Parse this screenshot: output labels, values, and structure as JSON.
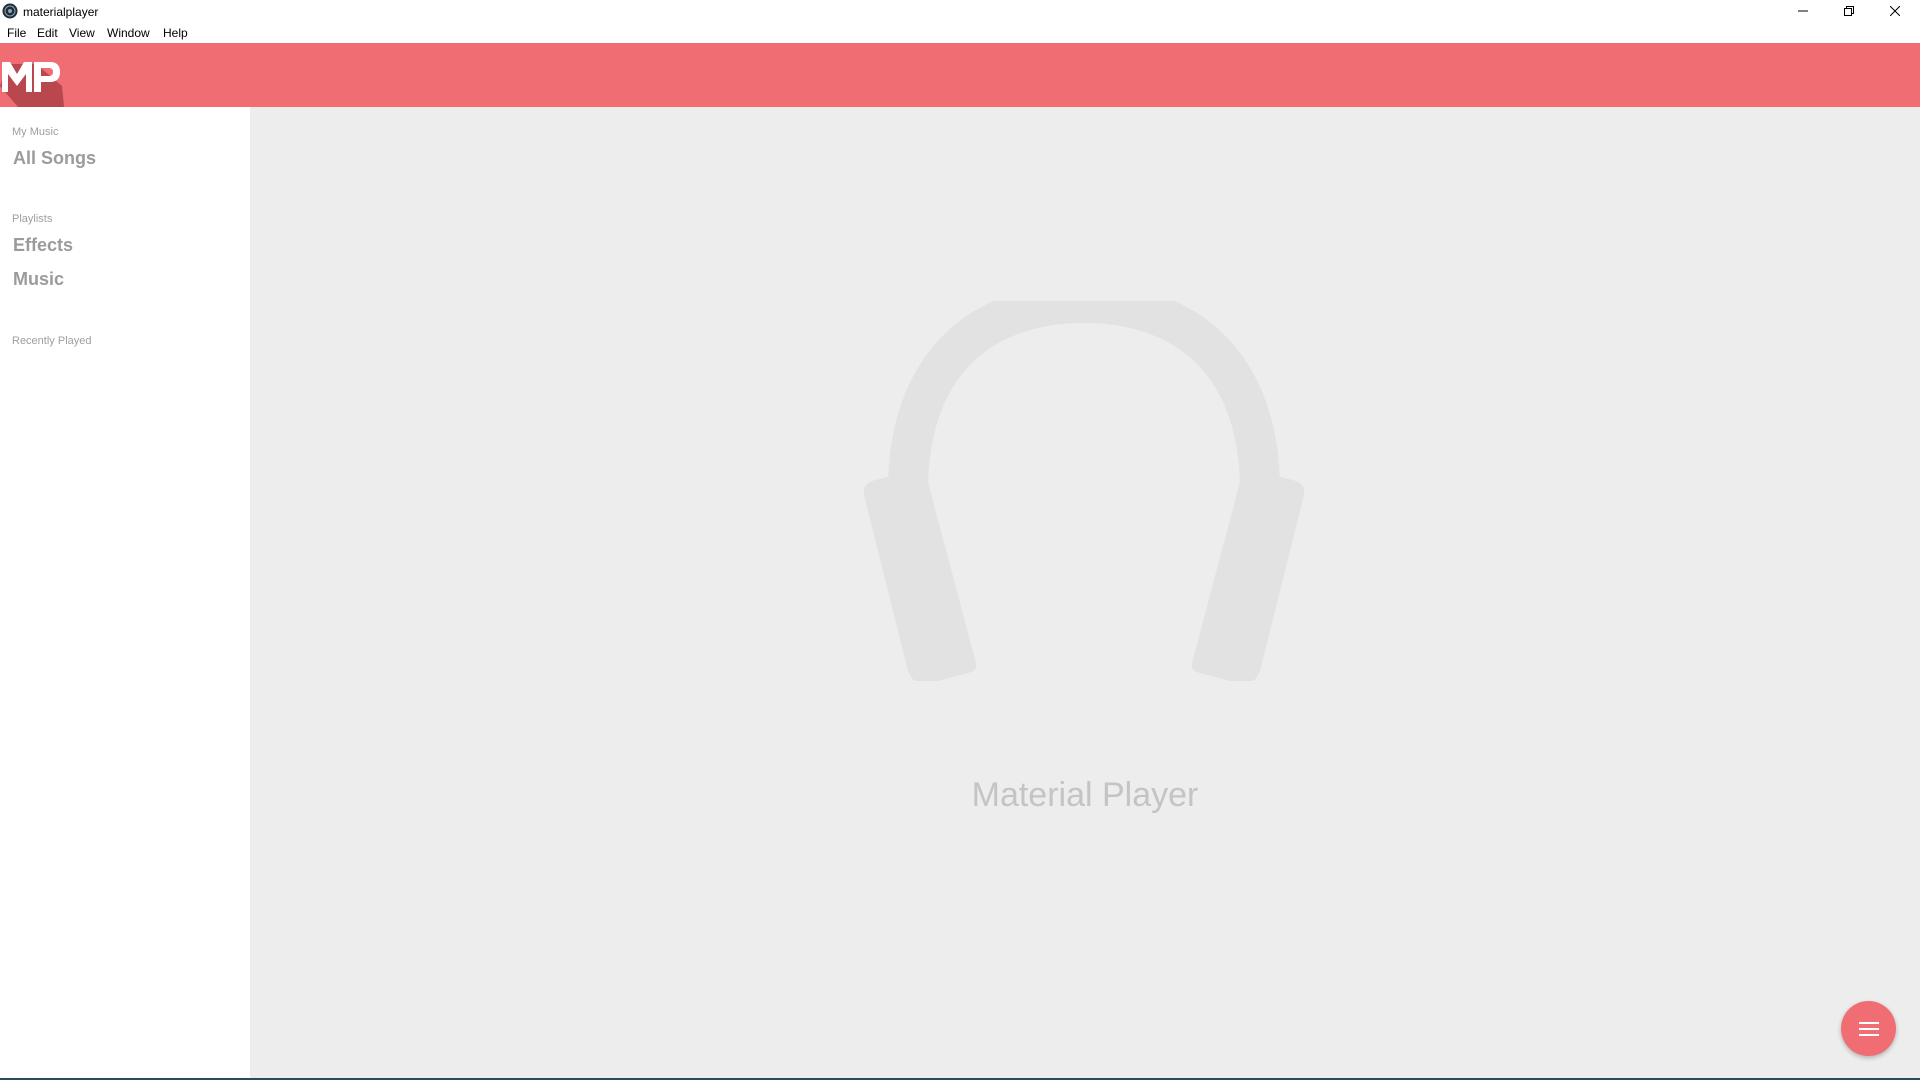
{
  "window": {
    "title": "materialplayer",
    "icon": "app-icon",
    "controls": [
      "minimize-icon",
      "maximize-icon",
      "close-icon"
    ]
  },
  "menu": {
    "file": "File",
    "edit": "Edit",
    "view": "View",
    "window": "Window",
    "help": "Help"
  },
  "header": {
    "logo_text": "MP",
    "accent_color": "#f06d74"
  },
  "sidebar": {
    "my_music_label": "My Music",
    "all_songs": "All Songs",
    "playlists_label": "Playlists",
    "playlists": [
      "Effects",
      "Music"
    ],
    "recently_played_label": "Recently Played"
  },
  "main": {
    "placeholder_icon": "headphones-icon",
    "app_name": "Material Player",
    "background_color": "#ededed"
  },
  "fab": {
    "icon": "menu-icon"
  }
}
